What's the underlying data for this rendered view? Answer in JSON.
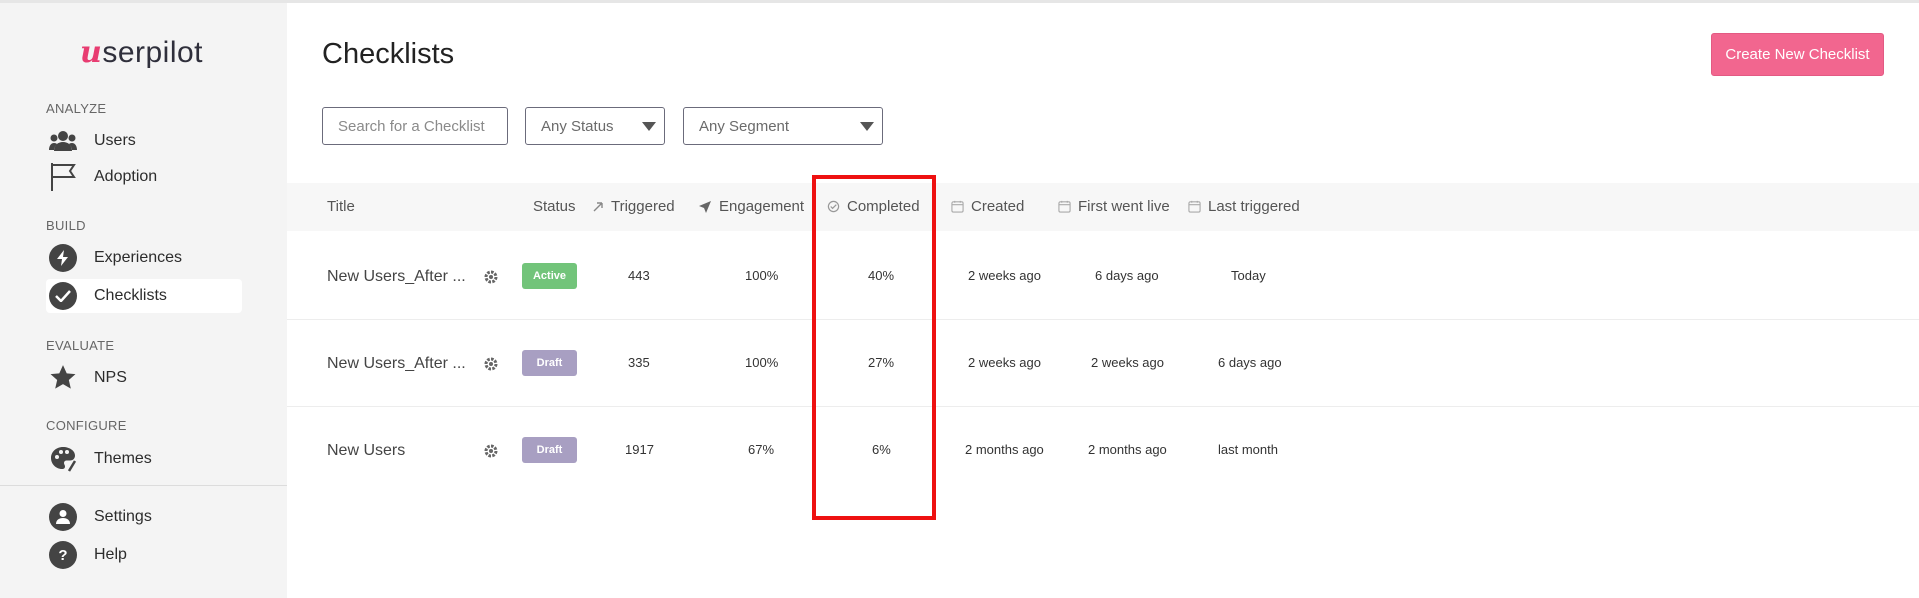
{
  "sidebar": {
    "logo_initial": "u",
    "logo_rest": "serpilot",
    "sections": {
      "analyze": "ANALYZE",
      "build": "BUILD",
      "evaluate": "EVALUATE",
      "configure": "CONFIGURE"
    },
    "items": [
      {
        "label": "Users",
        "icon": "users-icon"
      },
      {
        "label": "Adoption",
        "icon": "flag-icon"
      },
      {
        "label": "Experiences",
        "icon": "lightning-icon"
      },
      {
        "label": "Checklists",
        "icon": "check-circle-icon",
        "active": true
      },
      {
        "label": "NPS",
        "icon": "star-icon"
      },
      {
        "label": "Themes",
        "icon": "palette-icon"
      },
      {
        "label": "Settings",
        "icon": "user-circle-icon"
      },
      {
        "label": "Help",
        "icon": "question-icon"
      }
    ],
    "help_glyph": "?"
  },
  "header": {
    "title": "Checklists",
    "create_label": "Create New Checklist"
  },
  "filters": {
    "search_placeholder": "Search for a Checklist",
    "status_value": "Any Status",
    "segment_value": "Any Segment"
  },
  "table": {
    "columns": {
      "title": "Title",
      "status": "Status",
      "triggered": "Triggered",
      "engagement": "Engagement",
      "completed": "Completed",
      "created": "Created",
      "first_live": "First went live",
      "last_triggered": "Last triggered"
    },
    "rows": [
      {
        "title": "New Users_After ...",
        "status": "Active",
        "triggered": "443",
        "engagement": "100%",
        "completed": "40%",
        "created": "2 weeks ago",
        "first_live": "6 days ago",
        "last_triggered": "Today"
      },
      {
        "title": "New Users_After ...",
        "status": "Draft",
        "triggered": "335",
        "engagement": "100%",
        "completed": "27%",
        "created": "2 weeks ago",
        "first_live": "2 weeks ago",
        "last_triggered": "6 days ago"
      },
      {
        "title": "New Users",
        "status": "Draft",
        "triggered": "1917",
        "engagement": "67%",
        "completed": "6%",
        "created": "2 months ago",
        "first_live": "2 months ago",
        "last_triggered": "last month"
      }
    ]
  },
  "colors": {
    "brand": "#e83c71",
    "create_button": "#f2668f",
    "active_badge": "#72c47a",
    "draft_badge": "#a89fc2",
    "highlight_box": "#ee1111"
  }
}
